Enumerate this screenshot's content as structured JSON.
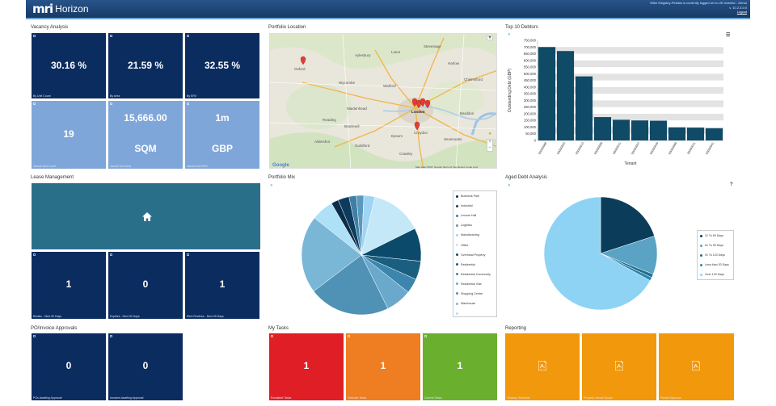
{
  "app": {
    "brand_mark": "mri",
    "name": "Horizon",
    "user_line1": "Ellen Kingsley-Perkins is currently logged on to UK Investor - Demo",
    "user_line2": "v. 10.2.3.0.0",
    "logout": "Logout"
  },
  "vacancy": {
    "title": "Vacancy Analysis",
    "tiles": [
      {
        "value": "30.16 %",
        "caption": "By Unit Count"
      },
      {
        "value": "21.59 %",
        "caption": "By Area"
      },
      {
        "value": "32.55 %",
        "caption": "By ERV"
      },
      {
        "value": "19",
        "caption": "Vacant Unit Count"
      },
      {
        "value": "15,666.00",
        "value2": "SQM",
        "caption": "Vacant Unit Area"
      },
      {
        "value": "1m",
        "value2": "GBP",
        "caption": "Vacant Unit ERV"
      }
    ]
  },
  "portfolio_location": {
    "title": "Portfolio Location",
    "places": [
      "Oxford",
      "Aylesbury",
      "Luton",
      "Stevenage",
      "Harlow",
      "Chelmsford",
      "Wycombe",
      "Watford",
      "Maidenhead",
      "Reading",
      "Bracknell",
      "London",
      "Basildon",
      "Guildford",
      "Crawley",
      "Epsom",
      "Croydon",
      "Sevenoaks",
      "Aldershot"
    ],
    "map_type": "Map",
    "footer": "Map data ©2017 Google   Terms of Use   Report a map error",
    "google": "Google"
  },
  "debtors": {
    "title": "Top 10 Debtors",
    "menu_icon": "hamburger-icon"
  },
  "chart_data": [
    {
      "type": "bar",
      "title": "Top 10 Debtors",
      "ylabel": "Outstanding Debt (GBP)",
      "xlabel": "Tenant",
      "ylim": [
        0,
        750000
      ],
      "yticks": [
        "0",
        "50,000",
        "100,000",
        "150,000",
        "200,000",
        "250,000",
        "300,000",
        "350,000",
        "400,000",
        "450,000",
        "500,000",
        "550,000",
        "600,000",
        "650,000",
        "700,000",
        "750,000"
      ],
      "categories": [
        "00000068",
        "00000053",
        "00000013",
        "00000056",
        "00000011",
        "00000057",
        "00000049",
        "00000069",
        "00000011",
        "00000041"
      ],
      "values": [
        700000,
        670000,
        480000,
        175000,
        155000,
        150000,
        148000,
        98000,
        96000,
        91000
      ],
      "grid": true
    },
    {
      "type": "pie",
      "title": "Portfolio Mix",
      "categories": [
        "Business Park",
        "Industrial",
        "Lecture Hall",
        "Logistics",
        "Manufacturing",
        "Office",
        "Overhead Property",
        "Residential",
        "Residential Community",
        "Residential Villa",
        "Shopping Centre",
        "Warehouse",
        ""
      ],
      "values": [
        2,
        3,
        2,
        2,
        3,
        14,
        9,
        5,
        4,
        7,
        22,
        21,
        6
      ],
      "colors": [
        "#0b2c4a",
        "#0d3b5e",
        "#3f7fa5",
        "#5a98be",
        "#9fd5f2",
        "#c4e8f8",
        "#0b4a6b",
        "#1a5f80",
        "#3c86ad",
        "#6aa9cc",
        "#4f92b5",
        "#7ab6d6",
        "#aee0f7"
      ]
    },
    {
      "type": "pie",
      "title": "Aged Debt Analysis",
      "categories": [
        "31 To 60 Days",
        "61 To 90 Days",
        "91 To 120 Days",
        "Less than 30 Days",
        "Over 120 Days"
      ],
      "values": [
        20,
        11,
        1,
        1,
        67
      ],
      "colors": [
        "#0b3d5a",
        "#5aa3c4",
        "#1f6f92",
        "#2e86ad",
        "#8fd3f4"
      ]
    }
  ],
  "lease": {
    "title": "Lease Management",
    "home_icon": "home-icon",
    "tiles": [
      {
        "value": "1",
        "caption": "Breaks - Next 30 Days"
      },
      {
        "value": "0",
        "caption": "Expiries - Next 30 Days"
      },
      {
        "value": "1",
        "caption": "Rent Reviews - Next 30 Days"
      }
    ]
  },
  "portfolio_mix": {
    "title": "Portfolio Mix"
  },
  "aged_debt": {
    "title": "Aged Debt Analysis",
    "help": "?"
  },
  "po": {
    "title": "PO/Invoice Approvals",
    "tiles": [
      {
        "value": "0",
        "caption": "POs Awaiting Approval"
      },
      {
        "value": "0",
        "caption": "Invoices Awaiting Approval"
      }
    ]
  },
  "tasks": {
    "title": "My Tasks",
    "tiles": [
      {
        "value": "1",
        "caption": "Escalated Tasks",
        "color": "#e01e25"
      },
      {
        "value": "1",
        "caption": "Overdue Tasks",
        "color": "#ef7d22"
      },
      {
        "value": "1",
        "caption": "Current Tasks",
        "color": "#6ab02e"
      }
    ]
  },
  "reporting": {
    "title": "Reporting",
    "tiles": [
      {
        "caption": "Tenancy Schedule",
        "icon": "pdf-icon"
      },
      {
        "caption": "Property Vacant Space",
        "icon": "pdf-icon"
      },
      {
        "caption": "Rental Exposure",
        "icon": "pdf-icon"
      }
    ]
  }
}
